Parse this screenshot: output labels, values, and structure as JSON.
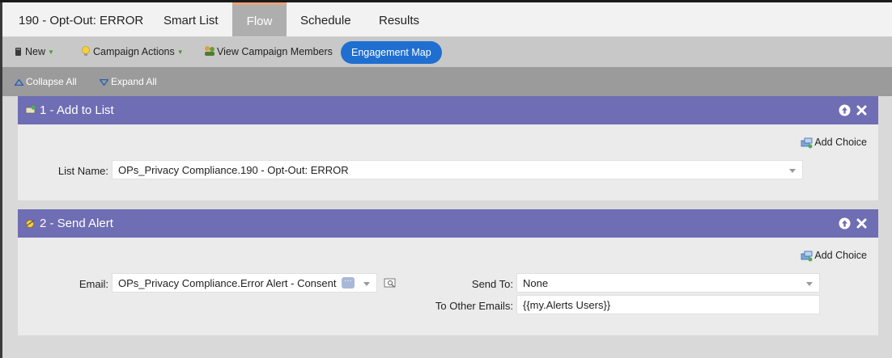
{
  "tabs": {
    "campaign_name": "190 - Opt-Out: ERROR",
    "smart_list": "Smart List",
    "flow": "Flow",
    "schedule": "Schedule",
    "results": "Results"
  },
  "toolbar": {
    "new_label": "New",
    "campaign_actions_label": "Campaign Actions",
    "view_members_label": "View Campaign Members",
    "engagement_map_label": "Engagement Map"
  },
  "subbar": {
    "collapse_all": "Collapse All",
    "expand_all": "Expand All"
  },
  "steps": [
    {
      "title": "1 - Add to List",
      "add_choice": "Add Choice",
      "list_name_label": "List Name:",
      "list_name_value": "OPs_Privacy Compliance.190 - Opt-Out: ERROR"
    },
    {
      "title": "2 - Send Alert",
      "add_choice": "Add Choice",
      "email_label": "Email:",
      "email_value": "OPs_Privacy Compliance.Error Alert - Consent",
      "send_to_label": "Send To:",
      "send_to_value": "None",
      "other_emails_label": "To Other Emails:",
      "other_emails_value": "{{my.Alerts Users}}"
    }
  ],
  "colors": {
    "step_header": "#6f6db3",
    "engagement_map_button": "#1f6fd1",
    "active_tab_accent": "#e8a37a"
  }
}
